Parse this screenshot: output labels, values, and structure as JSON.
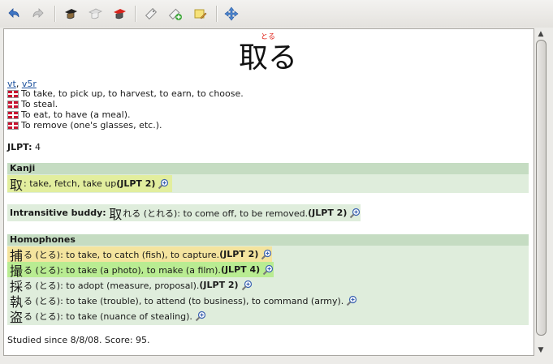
{
  "toolbar": {
    "buttons": [
      {
        "name": "back-button",
        "icon": "back-arrow-icon"
      },
      {
        "name": "forward-button",
        "icon": "forward-arrow-icon"
      },
      {
        "name": "graduation-button",
        "icon": "mortarboard-icon"
      },
      {
        "name": "mortarboard-disabled-button",
        "icon": "mortarboard-outline-icon"
      },
      {
        "name": "study-red-button",
        "icon": "mortarboard-red-icon"
      },
      {
        "name": "tag-button",
        "icon": "tag-icon"
      },
      {
        "name": "add-tag-button",
        "icon": "tag-add-icon"
      },
      {
        "name": "note-button",
        "icon": "note-icon"
      },
      {
        "name": "move-button",
        "icon": "move-icon"
      }
    ]
  },
  "entry": {
    "furigana": "とる",
    "headword": "取る",
    "pos": [
      "vt",
      "v5r"
    ],
    "senses": [
      "To take, to pick up, to harvest, to earn, to choose.",
      "To steal.",
      "To eat, to have (a meal).",
      "To remove (one's glasses, etc.)."
    ],
    "jlpt_label": "JLPT:",
    "jlpt_value": "4"
  },
  "kanji": {
    "header": "Kanji",
    "char": "取",
    "meaning": ": take, fetch, take up ",
    "jlpt": "(JLPT 2)"
  },
  "buddy": {
    "label": "Intransitive buddy:",
    "word_kanji": "取",
    "word_rest": "れる (とれる): to come off, to be removed. ",
    "jlpt": "(JLPT 2)"
  },
  "homophones": {
    "header": "Homophones",
    "items": [
      {
        "kanji": "捕",
        "rest": "る (とる): to take, to catch (fish), to capture. ",
        "jlpt": "(JLPT 2)",
        "color": "#f4e49e"
      },
      {
        "kanji": "撮",
        "rest": "る (とる): to take (a photo), to make (a film). ",
        "jlpt": "(JLPT 4)",
        "color": "#b9ec92"
      },
      {
        "kanji": "採",
        "rest": "る (とる): to adopt (measure, proposal). ",
        "jlpt": "(JLPT 2)",
        "color": ""
      },
      {
        "kanji": "執",
        "rest": "る (とる): to take (trouble), to attend (to business), to command (army). ",
        "jlpt": "",
        "color": ""
      },
      {
        "kanji": "盗",
        "rest": "る (とる): to take (nuance of stealing). ",
        "jlpt": "",
        "color": ""
      }
    ]
  },
  "footer": {
    "studied": "Studied since 8/8/08. Score: 95."
  },
  "colors": {
    "accent_red": "#e0241b",
    "box_bg": "#dfeddc",
    "box_header": "#c5dcc2",
    "kanji_highlight": "#e2ee9e"
  }
}
